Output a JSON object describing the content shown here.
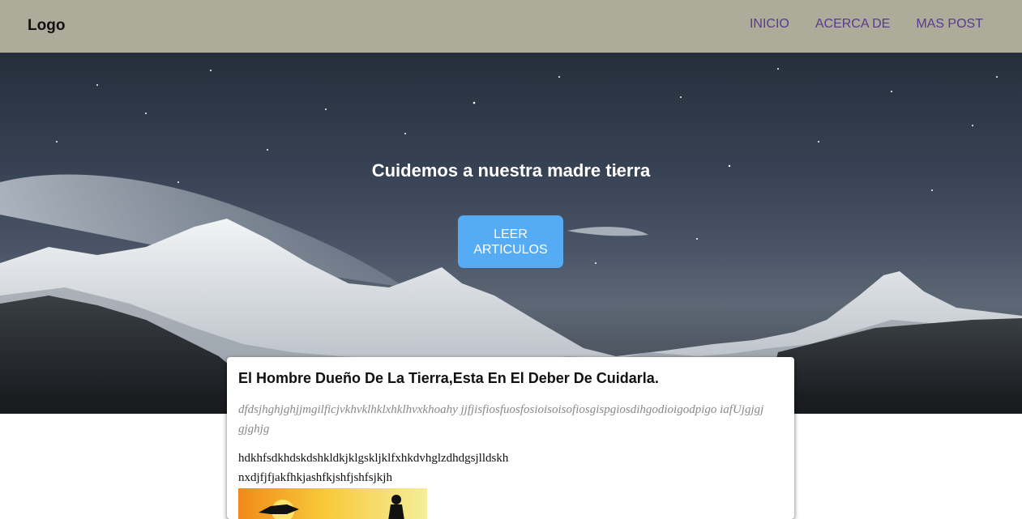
{
  "navbar": {
    "logo": "Logo",
    "links": [
      {
        "label": "INICIO"
      },
      {
        "label": "ACERCA DE"
      },
      {
        "label": "MAS POST"
      }
    ],
    "background_color": "#adab9a",
    "link_color": "#5a3a8c"
  },
  "hero": {
    "title": "Cuidemos a nuestra madre tierra",
    "button_label": "LEER ARTICULOS",
    "button_color": "#55acf5",
    "image": "snowy-mountains-night-sky"
  },
  "article": {
    "title": "El Hombre Dueño De La Tierra,Esta En El Deber De Cuidarla.",
    "subtitle": "dfdsjhghjghjjmgilficjvkhvklhklxhklhvxkhoahy jjfjisfiosfuosfosioisoisofiosgispgiosdihgodioigodpigo iafUjgjgjgjghjg",
    "body_line_1": "hdkhfsdkhdskdshkldkjklgskljklfxhkdvhglzdhdgsjlldskh",
    "body_line_2": "nxdjfjfjakfhkjashfkjshfjshfsjkjh",
    "image": "sunset-silhouette"
  }
}
